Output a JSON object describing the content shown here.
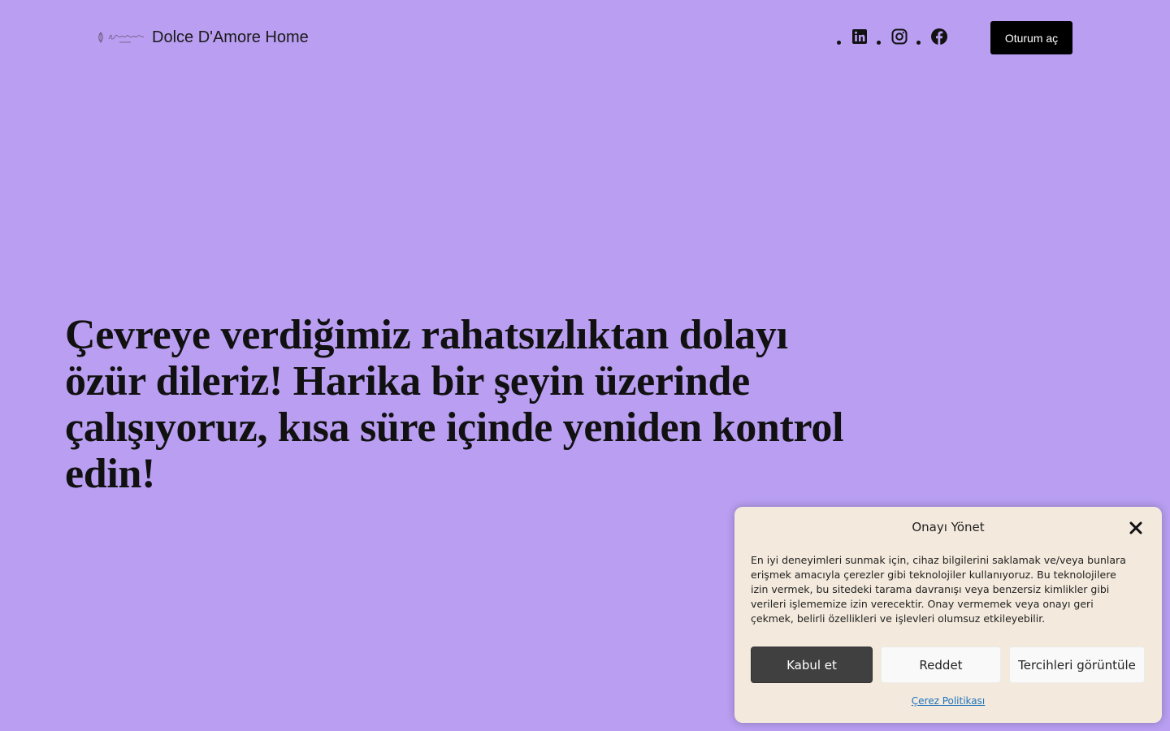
{
  "header": {
    "brand_name": "Dolce D'Amore Home",
    "logo_icon": "dolce-damore-logo",
    "social": [
      {
        "icon": "linkedin-icon"
      },
      {
        "icon": "instagram-icon"
      },
      {
        "icon": "facebook-icon"
      }
    ],
    "signin_label": "Oturum aç"
  },
  "main": {
    "message": "Çevreye verdiğimiz rahatsızlıktan dolayı özür dileriz! Harika bir şeyin üzerinde çalışıyoruz, kısa süre içinde yeniden kontrol edin!"
  },
  "cookie": {
    "title": "Onayı Yönet",
    "body": "En iyi deneyimleri sunmak için, cihaz bilgilerini saklamak ve/veya bunlara erişmek amacıyla çerezler gibi teknolojiler kullanıyoruz. Bu teknolojilere izin vermek, bu sitedeki tarama davranışı veya benzersiz kimlikler gibi verileri işlememize izin verecektir. Onay vermemek veya onayı geri çekmek, belirli özellikleri ve işlevleri olumsuz etkileyebilir.",
    "accept_label": "Kabul et",
    "deny_label": "Reddet",
    "prefs_label": "Tercihleri görüntüle",
    "policy_link": "Çerez Politikası"
  },
  "colors": {
    "background": "#b99ef1",
    "cookie_bg": "#f3e9dc",
    "accept_btn": "#404040",
    "button_dark": "#000000",
    "link": "#1e73be"
  }
}
